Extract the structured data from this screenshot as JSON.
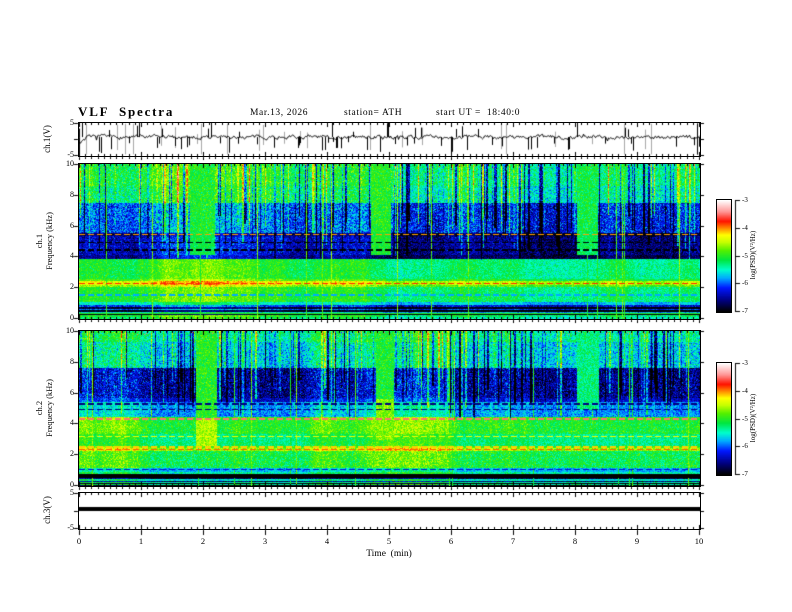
{
  "header": {
    "title": "VLF Spectra",
    "date": "Mar.13, 2026",
    "station": "station= ATH",
    "start_ut": "start UT =  18:40:0"
  },
  "axes": {
    "time_label": "Time  (min)",
    "time_ticks": [
      "0",
      "1",
      "2",
      "3",
      "4",
      "5",
      "6",
      "7",
      "8",
      "9",
      "10"
    ],
    "time_tick_vals": [
      0,
      1,
      2,
      3,
      4,
      5,
      6,
      7,
      8,
      9,
      10
    ],
    "time_range": [
      0,
      10
    ]
  },
  "panels": {
    "wave1": {
      "ylabel": "ch.1(V)",
      "yticks": [
        "5",
        "-5"
      ],
      "ytick_vals": [
        5,
        -5
      ],
      "range": [
        -5,
        5
      ]
    },
    "spec1": {
      "ylabel": "ch.1\nFrequency (kHz)",
      "yticks": [
        "10",
        "8",
        "6",
        "4",
        "2",
        "0"
      ],
      "ytick_vals": [
        10,
        8,
        6,
        4,
        2,
        0
      ],
      "range": [
        0,
        10
      ]
    },
    "spec2": {
      "ylabel": "ch.2\nFrequency (kHz)",
      "yticks": [
        "10",
        "8",
        "6",
        "4",
        "2",
        "0"
      ],
      "ytick_vals": [
        10,
        8,
        6,
        4,
        2,
        0
      ],
      "range": [
        0,
        10
      ]
    },
    "wave3": {
      "ylabel": "ch.3(V)",
      "yticks": [
        "5",
        "-5"
      ],
      "ytick_vals": [
        5,
        -5
      ],
      "range": [
        -5,
        5
      ]
    }
  },
  "colorbar": {
    "label": "log(PSD)(V²/Hz)",
    "ticks": [
      "-3",
      "-4",
      "-5",
      "-6",
      "-7"
    ],
    "tick_vals": [
      -3,
      -4,
      -5,
      -6,
      -7
    ],
    "range": [
      -7,
      -3
    ],
    "stops": [
      [
        -7,
        "#000000"
      ],
      [
        -6.6,
        "#00007f"
      ],
      [
        -6.15,
        "#0018ff"
      ],
      [
        -5.8,
        "#00aaff"
      ],
      [
        -5.5,
        "#00ffcc"
      ],
      [
        -5.15,
        "#00e640"
      ],
      [
        -4.8,
        "#55f000"
      ],
      [
        -4.5,
        "#c8ff00"
      ],
      [
        -4.25,
        "#ffff00"
      ],
      [
        -4.0,
        "#ff8800"
      ],
      [
        -3.75,
        "#ff1100"
      ],
      [
        -3.4,
        "#ff9999"
      ],
      [
        -3.0,
        "#ffffff"
      ]
    ]
  },
  "chart_data": [
    {
      "type": "line",
      "name": "ch1_voltage",
      "ylabel": "ch.1(V)",
      "xlim": [
        0,
        10
      ],
      "ylim": [
        -5,
        5
      ],
      "baseline": 0.6,
      "noise_amp": 0.45,
      "spike_count": 72,
      "spike_amp": [
        1.5,
        5
      ],
      "downward_fraction": 0.62,
      "grey_line_count": 24,
      "start_dip": -1.8
    },
    {
      "type": "heatmap",
      "name": "ch1_spectrogram",
      "xlabel": "Time  (min)",
      "ylabel": "ch.1 Frequency (kHz)",
      "xlim": [
        0,
        10
      ],
      "ylim": [
        0,
        10
      ],
      "zlim": [
        -7,
        -3
      ],
      "bands": [
        [
          0.0,
          0.1,
          -5.2,
          0.3
        ],
        [
          0.1,
          0.16,
          -7.0,
          0.15
        ],
        [
          0.16,
          0.24,
          -5.0,
          0.3
        ],
        [
          0.24,
          0.3,
          -7.0,
          0.15
        ],
        [
          0.3,
          0.42,
          -5.5,
          0.35
        ],
        [
          0.42,
          0.55,
          -6.9,
          0.25
        ],
        [
          0.55,
          0.62,
          -5.9,
          0.35
        ],
        [
          0.62,
          0.78,
          -6.8,
          0.25
        ],
        [
          0.78,
          0.92,
          -6.1,
          0.4
        ],
        [
          0.92,
          1.1,
          -5.5,
          0.25
        ],
        [
          1.1,
          2.05,
          -5.0,
          0.3
        ],
        [
          2.05,
          2.2,
          -4.6,
          0.35
        ],
        [
          2.2,
          2.45,
          -4.3,
          0.3
        ],
        [
          2.45,
          2.6,
          -4.8,
          0.25
        ],
        [
          2.6,
          3.9,
          -5.05,
          0.3
        ],
        [
          3.9,
          4.15,
          -6.5,
          0.3
        ],
        [
          4.15,
          5.35,
          -6.35,
          0.4
        ],
        [
          5.35,
          5.55,
          -6.6,
          0.3
        ],
        [
          5.55,
          7.5,
          -5.95,
          0.55
        ],
        [
          7.5,
          8.6,
          -5.2,
          0.5
        ],
        [
          8.6,
          10.0,
          -5.05,
          0.45
        ]
      ],
      "hlines": [
        [
          5.45,
          -4.05,
          1
        ],
        [
          2.28,
          -3.8,
          1
        ],
        [
          4.45,
          -7.0,
          1
        ],
        [
          4.95,
          -7.0,
          1
        ],
        [
          0.35,
          -5.0,
          0
        ],
        [
          1.55,
          -5.8,
          1
        ]
      ],
      "patches": [
        [
          1.78,
          2.18,
          4.1,
          5.5,
          -5.15,
          0.25
        ],
        [
          1.78,
          2.18,
          5.5,
          10.0,
          -5.05,
          0.35
        ],
        [
          4.7,
          5.03,
          4.1,
          5.6,
          -5.05,
          0.25
        ],
        [
          4.7,
          5.03,
          5.6,
          10.0,
          -5.0,
          0.35
        ],
        [
          8.03,
          8.36,
          4.1,
          5.5,
          -5.2,
          0.25
        ],
        [
          8.03,
          8.36,
          5.5,
          10.0,
          -5.15,
          0.35
        ]
      ],
      "streaks": {
        "count": 240,
        "fmin": [
          3.8,
          6.8
        ],
        "delta": [
          -1.9,
          1.5
        ],
        "full_count": 16,
        "full_level": -4.85
      }
    },
    {
      "type": "heatmap",
      "name": "ch2_spectrogram",
      "xlabel": "Time  (min)",
      "ylabel": "ch.2 Frequency (kHz)",
      "xlim": [
        0,
        10
      ],
      "ylim": [
        0,
        10
      ],
      "zlim": [
        -7,
        -3
      ],
      "bands": [
        [
          0.0,
          0.08,
          -6.8,
          0.2
        ],
        [
          0.08,
          0.14,
          -5.0,
          0.3
        ],
        [
          0.14,
          0.2,
          -6.9,
          0.2
        ],
        [
          0.2,
          0.26,
          -5.1,
          0.3
        ],
        [
          0.26,
          0.34,
          -6.4,
          0.3
        ],
        [
          0.34,
          0.44,
          -5.2,
          0.3
        ],
        [
          0.44,
          0.52,
          -6.5,
          0.3
        ],
        [
          0.52,
          0.92,
          -5.1,
          0.35
        ],
        [
          0.92,
          1.15,
          -5.4,
          0.3
        ],
        [
          1.15,
          2.25,
          -4.8,
          0.4
        ],
        [
          2.25,
          2.42,
          -4.25,
          0.35
        ],
        [
          2.42,
          2.55,
          -4.6,
          0.3
        ],
        [
          2.55,
          3.35,
          -4.95,
          0.3
        ],
        [
          3.35,
          4.25,
          -4.7,
          0.35
        ],
        [
          4.25,
          4.42,
          -4.6,
          0.3
        ],
        [
          4.42,
          5.45,
          -5.5,
          0.35
        ],
        [
          5.45,
          5.65,
          -6.0,
          0.35
        ],
        [
          5.65,
          7.6,
          -6.2,
          0.55
        ],
        [
          7.6,
          9.3,
          -5.3,
          0.5
        ],
        [
          9.3,
          10.0,
          -5.05,
          0.45
        ]
      ],
      "hlines": [
        [
          4.33,
          -3.5,
          1
        ],
        [
          2.35,
          -3.9,
          1
        ],
        [
          2.52,
          -4.15,
          1
        ],
        [
          3.18,
          -4.3,
          1
        ],
        [
          0.58,
          -7.0,
          0
        ],
        [
          0.72,
          -7.0,
          0
        ],
        [
          4.95,
          -6.6,
          1
        ],
        [
          5.3,
          -6.6,
          1
        ],
        [
          1.05,
          -6.3,
          1
        ]
      ],
      "patches": [
        [
          1.88,
          2.22,
          2.6,
          4.4,
          -4.55,
          0.3
        ],
        [
          1.88,
          2.22,
          4.4,
          10.0,
          -5.0,
          0.35
        ],
        [
          4.78,
          5.08,
          3.0,
          5.6,
          -4.7,
          0.3
        ],
        [
          4.78,
          5.08,
          5.6,
          10.0,
          -5.05,
          0.35
        ],
        [
          8.02,
          8.38,
          4.9,
          10.0,
          -5.3,
          0.35
        ]
      ],
      "streaks": {
        "count": 220,
        "fmin": [
          4.2,
          7.0
        ],
        "delta": [
          -1.9,
          1.4
        ],
        "full_count": 14,
        "full_level": -4.9
      }
    },
    {
      "type": "line",
      "name": "ch3_voltage",
      "ylabel": "ch.3(V)",
      "xlim": [
        0,
        10
      ],
      "ylim": [
        -5,
        5
      ],
      "constant_value": 0.3,
      "line_thickness_px": 4
    }
  ]
}
